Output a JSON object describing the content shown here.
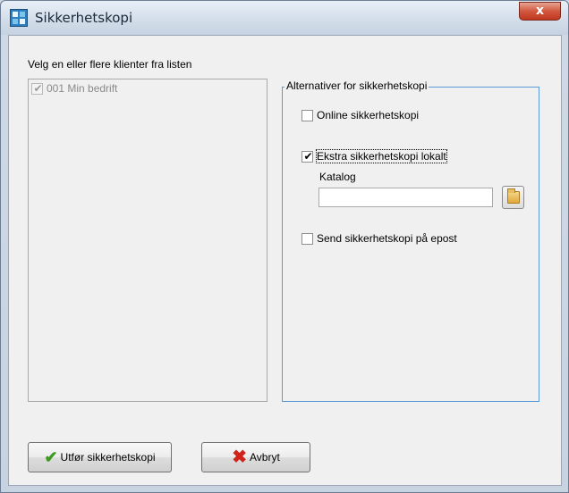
{
  "window": {
    "title": "Sikkerhetskopi",
    "close_glyph": "x",
    "app_icon": "app-grid-icon"
  },
  "clients": {
    "label": "Velg en eller flere klienter fra listen",
    "items": [
      {
        "label": "001 Min bedrift",
        "checked": true,
        "enabled": false
      }
    ]
  },
  "options": {
    "legend": "Alternativer for sikkerhetskopi",
    "online": {
      "label": "Online sikkerhetskopi",
      "checked": false
    },
    "local": {
      "label": "Ekstra sikkerhetskopi lokalt",
      "checked": true
    },
    "katalog": {
      "label": "Katalog",
      "value": "",
      "browse_icon": "folder-icon"
    },
    "email": {
      "label": "Send sikkerhetskopi på epost",
      "checked": false
    }
  },
  "buttons": {
    "execute": {
      "label": "Utfør sikkerhetskopi",
      "icon": "checkmark-icon"
    },
    "cancel": {
      "label": "Avbryt",
      "icon": "red-x-icon"
    }
  },
  "colors": {
    "groupbox_border": "#5a9ad6",
    "close_button": "#c0371e",
    "check_icon": "#3c9a1e",
    "cancel_icon": "#d0231b"
  }
}
